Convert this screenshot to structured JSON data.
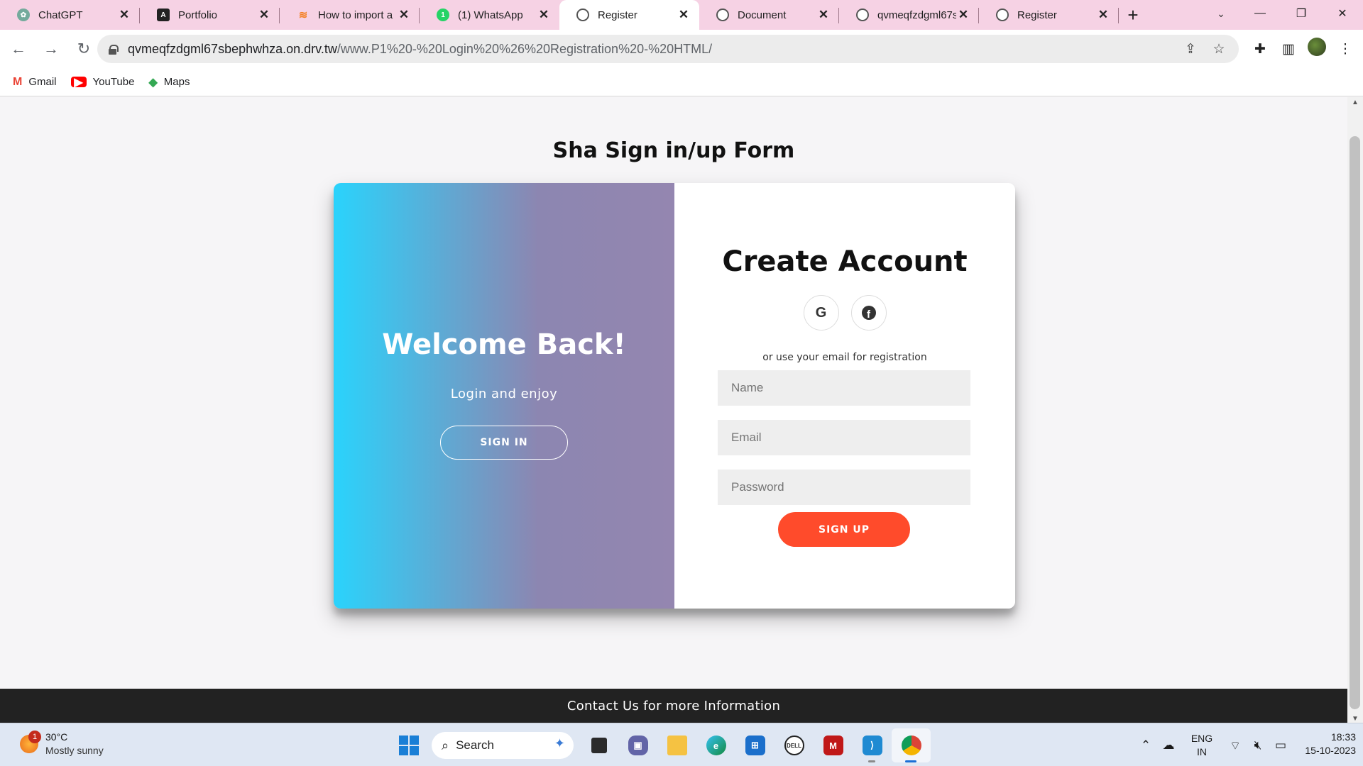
{
  "browser": {
    "tabs": [
      {
        "title": "ChatGPT",
        "icon": "chatgpt-icon",
        "active": false
      },
      {
        "title": "Portfolio",
        "icon": "angular-icon",
        "active": false
      },
      {
        "title": "How to import a",
        "icon": "stackoverflow-icon",
        "active": false
      },
      {
        "title": "(1) WhatsApp",
        "icon": "whatsapp-icon",
        "active": false
      },
      {
        "title": "Register",
        "icon": "globe-icon",
        "active": true
      },
      {
        "title": "Document",
        "icon": "globe-icon",
        "active": false
      },
      {
        "title": "qvmeqfzdgml67s",
        "icon": "globe-icon",
        "active": false
      },
      {
        "title": "Register",
        "icon": "globe-icon",
        "active": false
      }
    ],
    "address": {
      "host": "qvmeqfzdgml67sbephwhza.on.drv.tw",
      "path": "/www.P1%20-%20Login%20%26%20Registration%20-%20HTML/"
    },
    "bookmarks": [
      {
        "label": "Gmail",
        "icon": "gmail-icon"
      },
      {
        "label": "YouTube",
        "icon": "youtube-icon"
      },
      {
        "label": "Maps",
        "icon": "maps-icon"
      }
    ]
  },
  "page": {
    "title": "Sha Sign in/up Form",
    "overlay": {
      "heading": "Welcome Back!",
      "text": "Login and enjoy",
      "button": "SIGN IN"
    },
    "form": {
      "heading": "Create Account",
      "social": [
        "google-icon",
        "facebook-icon"
      ],
      "or_text": "or use your email for registration",
      "name_placeholder": "Name",
      "email_placeholder": "Email",
      "password_placeholder": "Password",
      "submit": "SIGN UP"
    },
    "footer": "Contact Us for more Information"
  },
  "colors": {
    "gradient_start": "#2ad3fc",
    "gradient_end": "#9486b0",
    "signup_button": "#ff4b2b",
    "footer_bg": "#222222",
    "tab_strip": "#f6d2e4"
  },
  "taskbar": {
    "weather": {
      "temp": "30°C",
      "condition": "Mostly sunny",
      "badge": "1"
    },
    "search_label": "Search",
    "language": {
      "line1": "ENG",
      "line2": "IN"
    },
    "clock": {
      "time": "18:33",
      "date": "15-10-2023"
    }
  }
}
